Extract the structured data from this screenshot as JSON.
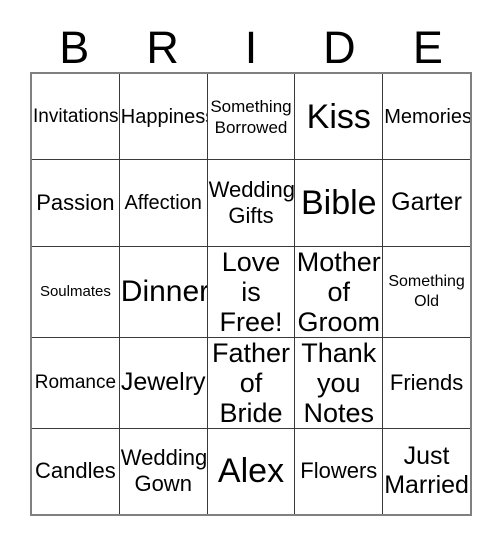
{
  "card": {
    "title_letters": [
      "B",
      "R",
      "I",
      "D",
      "E"
    ],
    "columns": 5,
    "rows": 5,
    "colors": {
      "background": "#ffffff",
      "text": "#000000",
      "grid_line": "#3a3a3a",
      "outer_border": "#808080"
    },
    "cells": [
      [
        {
          "text": "Invitations",
          "size": "sz-m"
        },
        {
          "text": "Happiness",
          "size": "sz-ml"
        },
        {
          "text": "Something\nBorrowed",
          "size": "sz-sm"
        },
        {
          "text": "Kiss",
          "size": "sz-h2"
        },
        {
          "text": "Memories",
          "size": "sz-ml"
        }
      ],
      [
        {
          "text": "Passion",
          "size": "sz-l"
        },
        {
          "text": "Affection",
          "size": "sz-ml"
        },
        {
          "text": "Wedding\nGifts",
          "size": "sz-l"
        },
        {
          "text": "Bible",
          "size": "sz-h2"
        },
        {
          "text": "Garter",
          "size": "sz-xl"
        }
      ],
      [
        {
          "text": "Soulmates",
          "size": "sz-xs"
        },
        {
          "text": "Dinner",
          "size": "sz-h1"
        },
        {
          "text": "Love\nis\nFree!",
          "size": "sz-xxl"
        },
        {
          "text": "Mother\nof\nGroom",
          "size": "sz-xxl"
        },
        {
          "text": "Something\nOld",
          "size": "sz-s"
        }
      ],
      [
        {
          "text": "Romance",
          "size": "sz-m"
        },
        {
          "text": "Jewelry",
          "size": "sz-xl"
        },
        {
          "text": "Father\nof\nBride",
          "size": "sz-xxl"
        },
        {
          "text": "Thank\nyou\nNotes",
          "size": "sz-xxl"
        },
        {
          "text": "Friends",
          "size": "sz-l"
        }
      ],
      [
        {
          "text": "Candles",
          "size": "sz-l"
        },
        {
          "text": "Wedding\nGown",
          "size": "sz-l"
        },
        {
          "text": "Alex",
          "size": "sz-h2"
        },
        {
          "text": "Flowers",
          "size": "sz-l"
        },
        {
          "text": "Just\nMarried",
          "size": "sz-xl"
        }
      ]
    ]
  }
}
